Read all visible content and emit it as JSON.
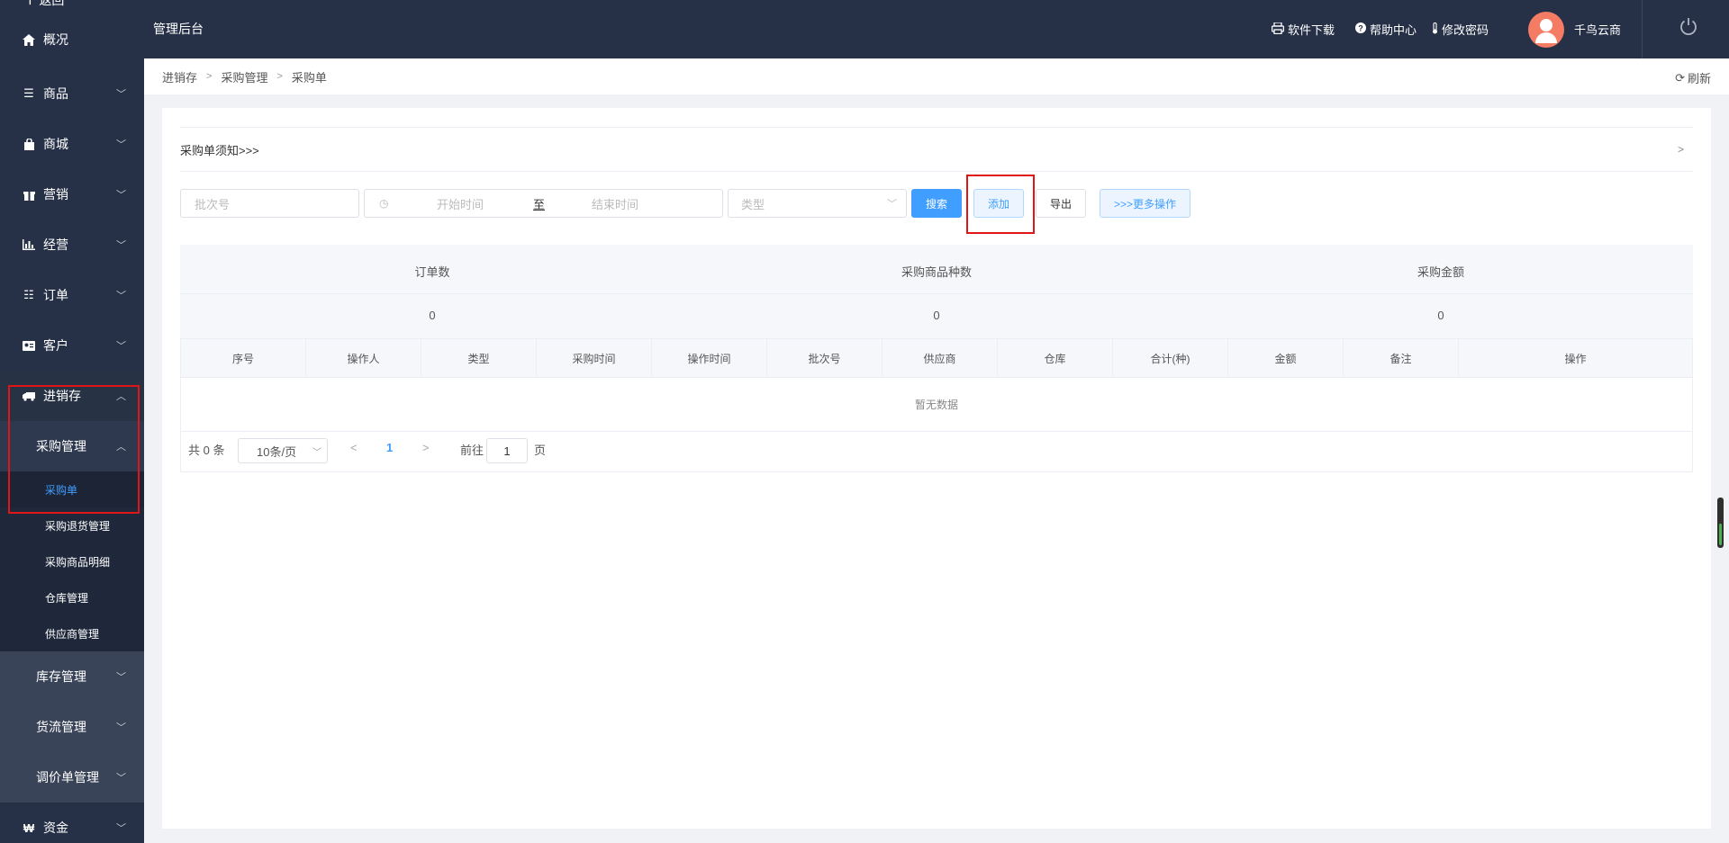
{
  "sidebar": {
    "back_label": "返回",
    "items": [
      {
        "label": "概况",
        "icon": "home-icon",
        "expandable": false
      },
      {
        "label": "商品",
        "icon": "list-icon",
        "expandable": true
      },
      {
        "label": "商城",
        "icon": "bag-icon",
        "expandable": true
      },
      {
        "label": "营销",
        "icon": "gift-icon",
        "expandable": true
      },
      {
        "label": "经营",
        "icon": "bar-chart-icon",
        "expandable": true
      },
      {
        "label": "订单",
        "icon": "list-icon",
        "expandable": true
      },
      {
        "label": "客户",
        "icon": "id-card-icon",
        "expandable": true
      }
    ],
    "open_item": {
      "label": "进销存",
      "icon": "truck-icon"
    },
    "open_sub": {
      "label": "采购管理"
    },
    "leaves": [
      {
        "label": "采购单",
        "active": true
      },
      {
        "label": "采购退货管理",
        "active": false
      },
      {
        "label": "采购商品明细",
        "active": false
      },
      {
        "label": "仓库管理",
        "active": false
      },
      {
        "label": "供应商管理",
        "active": false
      }
    ],
    "groups": [
      {
        "label": "库存管理"
      },
      {
        "label": "货流管理"
      },
      {
        "label": "调价单管理"
      }
    ],
    "bottom_item": {
      "label": "资金",
      "icon": "won-icon"
    }
  },
  "topbar": {
    "title": "管理后台",
    "links": [
      {
        "label": "软件下载",
        "icon": "printer-icon"
      },
      {
        "label": "帮助中心",
        "icon": "question-icon"
      },
      {
        "label": "修改密码",
        "icon": "thermometer-icon"
      }
    ],
    "user_name": "千鸟云商"
  },
  "breadcrumb": {
    "items": [
      "进销存",
      "采购管理",
      "采购单"
    ],
    "refresh_label": "刷新"
  },
  "notice": {
    "label": "采购单须知>>>"
  },
  "filters": {
    "batch_placeholder": "批次号",
    "start_placeholder": "开始时间",
    "range_sep": "至",
    "end_placeholder": "结束时间",
    "type_placeholder": "类型",
    "search_label": "搜索",
    "add_label": "添加",
    "export_label": "导出",
    "more_label": ">>>更多操作"
  },
  "summary": {
    "columns": [
      {
        "label": "订单数",
        "value": "0"
      },
      {
        "label": "采购商品种数",
        "value": "0"
      },
      {
        "label": "采购金额",
        "value": "0"
      }
    ]
  },
  "table": {
    "headers": [
      "序号",
      "操作人",
      "类型",
      "采购时间",
      "操作时间",
      "批次号",
      "供应商",
      "仓库",
      "合计(种)",
      "金额",
      "备注",
      "操作"
    ],
    "empty_text": "暂无数据"
  },
  "pagination": {
    "total_label": "共 0 条",
    "page_size": "10条/页",
    "current_page": "1",
    "goto_label": "前往",
    "goto_value": "1",
    "page_suffix": "页"
  },
  "colors": {
    "sidebar_bg": "#263047",
    "accent": "#409eff",
    "highlight_box": "#e01515",
    "avatar": "#f47c64"
  }
}
